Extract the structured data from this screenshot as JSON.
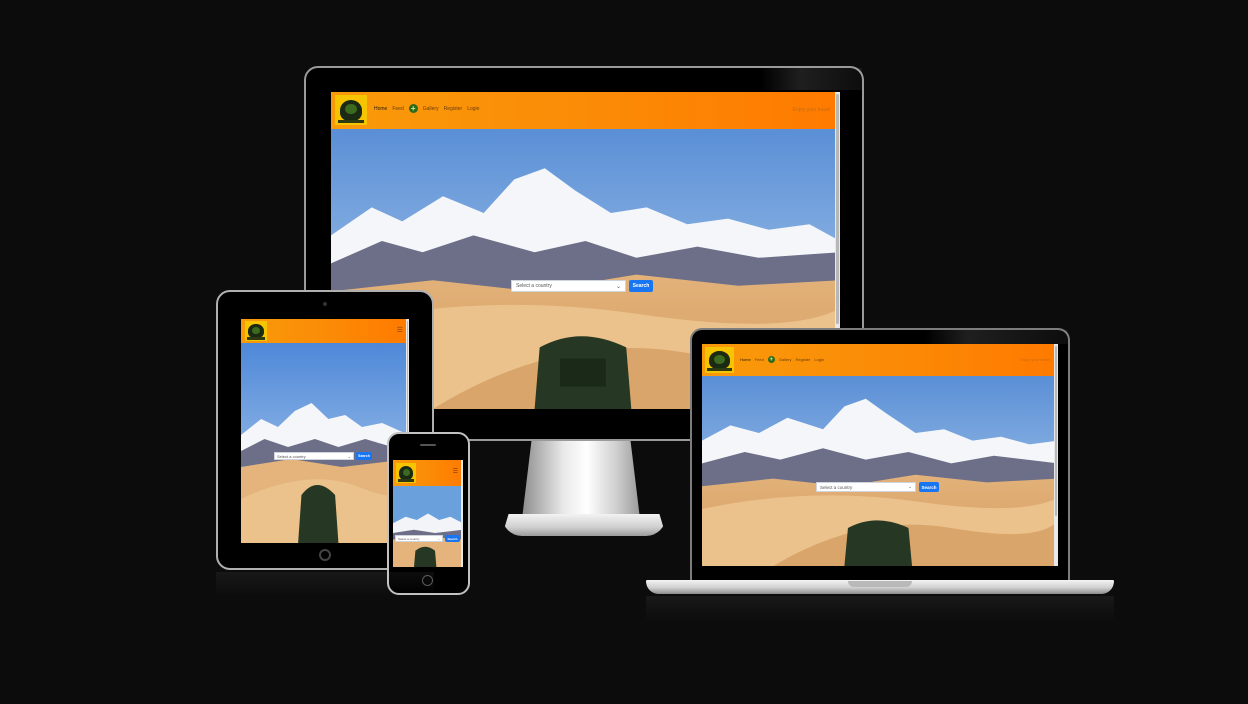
{
  "site": {
    "nav": {
      "home": "Home",
      "feed": "Feed",
      "add_icon": "plus-icon",
      "gallery": "Gallery",
      "register": "Register",
      "login": "Login",
      "right_text": "Enjoy your travel"
    },
    "search": {
      "placeholder": "Select a country",
      "button": "Search"
    },
    "colors": {
      "nav_gradient_start": "#f99a0a",
      "nav_gradient_end": "#ff7a00",
      "search_button": "#1976f2",
      "logo_bg": "#f7c400"
    }
  },
  "devices": [
    "desktop-monitor",
    "tablet",
    "phone",
    "laptop"
  ]
}
